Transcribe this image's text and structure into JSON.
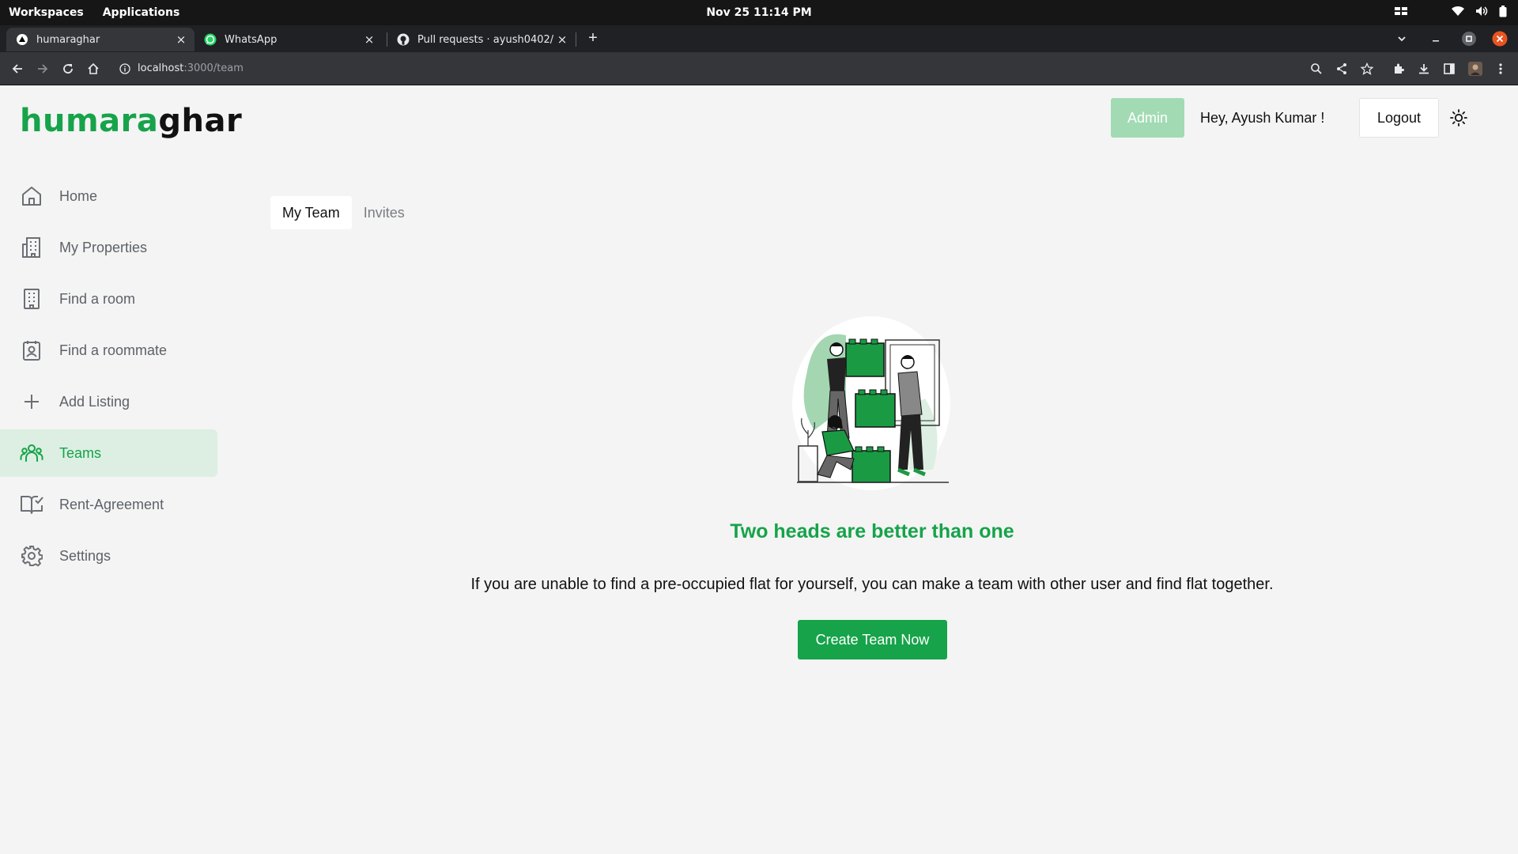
{
  "os": {
    "workspaces": "Workspaces",
    "applications": "Applications",
    "datetime": "Nov 25  11:14 PM"
  },
  "browser": {
    "tabs": [
      {
        "title": "humaraghar",
        "icon": "nextjs-icon"
      },
      {
        "title": "WhatsApp",
        "icon": "whatsapp-icon"
      },
      {
        "title": "Pull requests · ayush0402/hu",
        "icon": "github-icon"
      }
    ],
    "url_host": "localhost",
    "url_path": ":3000/team"
  },
  "app": {
    "logo_part1": "humara",
    "logo_part2": "ghar",
    "admin_label": "Admin",
    "greeting": "Hey, Ayush Kumar !",
    "logout_label": "Logout"
  },
  "sidebar": {
    "items": [
      {
        "label": "Home",
        "icon": "home-icon"
      },
      {
        "label": "My Properties",
        "icon": "building-icon"
      },
      {
        "label": "Find a room",
        "icon": "apartment-icon"
      },
      {
        "label": "Find a roommate",
        "icon": "contact-icon"
      },
      {
        "label": "Add Listing",
        "icon": "plus-icon"
      },
      {
        "label": "Teams",
        "icon": "users-icon",
        "active": true
      },
      {
        "label": "Rent-Agreement",
        "icon": "book-check-icon"
      },
      {
        "label": "Settings",
        "icon": "gear-icon"
      }
    ]
  },
  "main": {
    "tabs": [
      {
        "label": "My Team",
        "active": true
      },
      {
        "label": "Invites"
      }
    ],
    "headline": "Two heads are better than one",
    "description": "If you are unable to find a pre-occupied flat for yourself, you can make a team with other user and find flat together.",
    "cta_label": "Create Team Now"
  },
  "colors": {
    "brand": "#16a34a",
    "brand_light": "#a2dbb3",
    "active_bg": "#dcefe2"
  }
}
